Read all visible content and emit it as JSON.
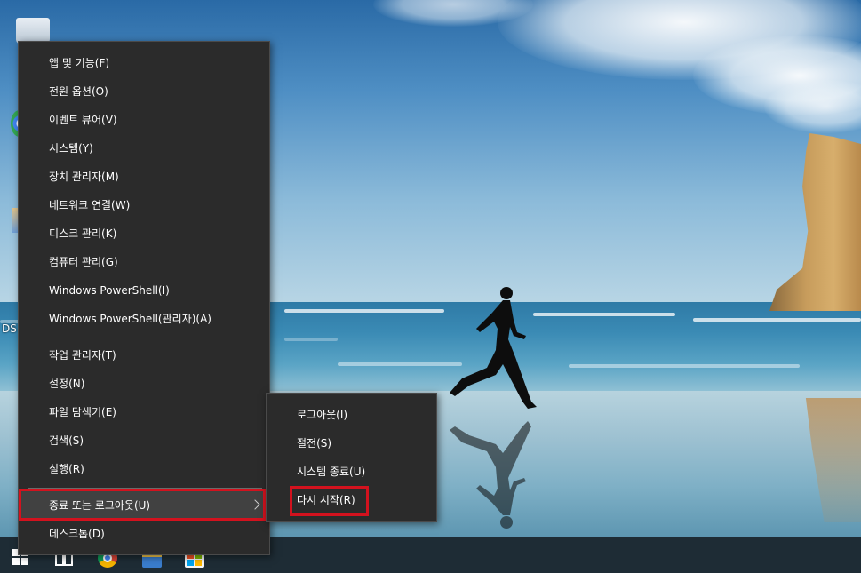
{
  "desktop": {
    "partial_label": "DS"
  },
  "context_menu": {
    "group1": [
      {
        "label": "앱 및 기능(F)"
      },
      {
        "label": "전원 옵션(O)"
      },
      {
        "label": "이벤트 뷰어(V)"
      },
      {
        "label": "시스템(Y)"
      },
      {
        "label": "장치 관리자(M)"
      },
      {
        "label": "네트워크 연결(W)"
      },
      {
        "label": "디스크 관리(K)"
      },
      {
        "label": "컴퓨터 관리(G)"
      },
      {
        "label": "Windows PowerShell(I)"
      },
      {
        "label": "Windows PowerShell(관리자)(A)"
      }
    ],
    "group2": [
      {
        "label": "작업 관리자(T)"
      },
      {
        "label": "설정(N)"
      },
      {
        "label": "파일 탐색기(E)"
      },
      {
        "label": "검색(S)"
      },
      {
        "label": "실행(R)"
      }
    ],
    "group3": [
      {
        "label": "종료 또는 로그아웃(U)",
        "has_submenu": true,
        "highlighted": true
      },
      {
        "label": "데스크톱(D)"
      }
    ]
  },
  "submenu": {
    "items": [
      {
        "label": "로그아웃(I)"
      },
      {
        "label": "절전(S)"
      },
      {
        "label": "시스템 종료(U)"
      },
      {
        "label": "다시 시작(R)",
        "highlighted": true
      }
    ]
  },
  "taskbar": {
    "icons": [
      "windows-start-icon",
      "task-view-icon",
      "chrome-icon",
      "file-explorer-icon",
      "microsoft-store-icon"
    ]
  },
  "colors": {
    "menu_bg": "#2b2b2b",
    "menu_text": "#ffffff",
    "highlight_border": "#d3121e",
    "taskbar_bg": "#1e2c35"
  }
}
